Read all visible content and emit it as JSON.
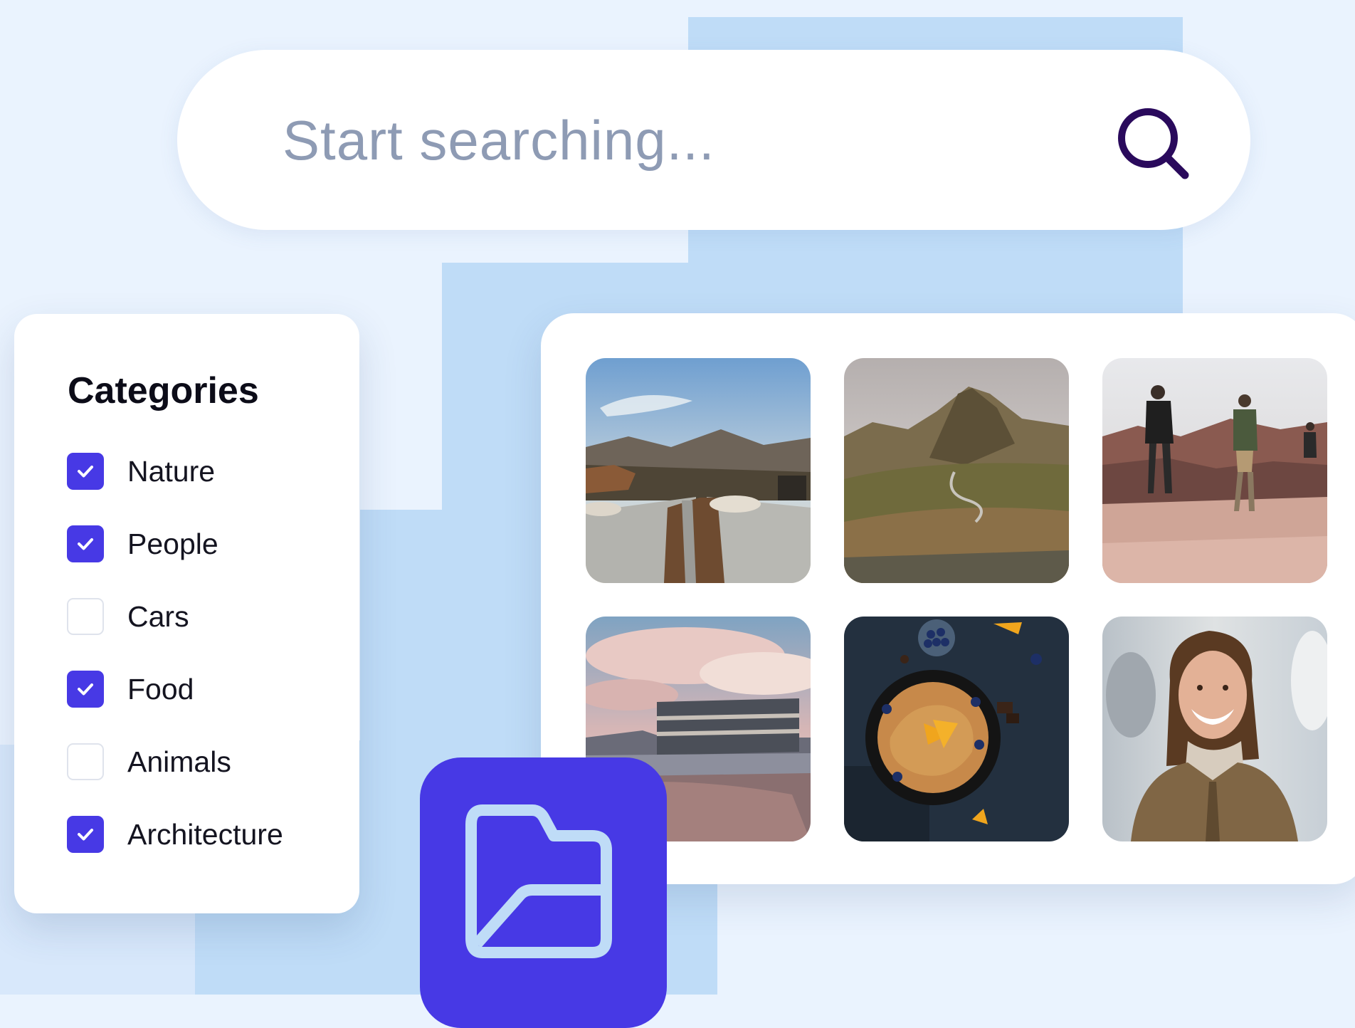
{
  "search": {
    "placeholder": "Start searching..."
  },
  "categories": {
    "title": "Categories",
    "items": [
      {
        "label": "Nature",
        "checked": true
      },
      {
        "label": "People",
        "checked": true
      },
      {
        "label": "Cars",
        "checked": false
      },
      {
        "label": "Food",
        "checked": true
      },
      {
        "label": "Animals",
        "checked": false
      },
      {
        "label": "Architecture",
        "checked": true
      }
    ]
  },
  "gallery": {
    "photos": [
      {
        "subject": "mountain resort rooftop at sunset"
      },
      {
        "subject": "green mountain valley with winding road"
      },
      {
        "subject": "hikers on rocky cliff"
      },
      {
        "subject": "seaside hotel under pink clouds"
      },
      {
        "subject": "pancake skillet with blueberries and oranges"
      },
      {
        "subject": "smiling woman in brown coat"
      }
    ]
  },
  "icons": {
    "search": "search-icon",
    "folder": "folder-icon",
    "check": "check-icon"
  },
  "colors": {
    "accent": "#4739e5",
    "background": "#eaf3fe",
    "decor_blue": "#bfdcf7",
    "search_icon": "#2a0a5c",
    "placeholder_text": "#8e9bb4"
  }
}
